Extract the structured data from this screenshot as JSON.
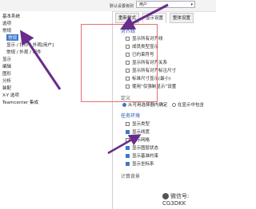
{
  "topbar": {
    "label": "默认设置级别",
    "select_value": "用户"
  },
  "tabs": [
    {
      "label": "重新样式"
    },
    {
      "label": "显示设置"
    },
    {
      "label": "整体设置"
    }
  ],
  "sidebar": {
    "items": [
      {
        "label": "基本系统"
      },
      {
        "label": "选项"
      },
      {
        "label": "常规"
      },
      {
        "label": "常规"
      },
      {
        "label": "显示 / 打印 / 外观[用户]"
      },
      {
        "label": "常规 / 外观 / 组件"
      },
      {
        "label": "显示"
      },
      {
        "label": "编辑"
      },
      {
        "label": "图形"
      },
      {
        "label": "分析"
      },
      {
        "label": "装配"
      },
      {
        "label": "X-Y 选项"
      },
      {
        "label": "Teamcenter 集成"
      }
    ]
  },
  "panel": {
    "section1_title": "对齐线",
    "options": [
      {
        "label": "显示所有对齐线",
        "checked": false
      },
      {
        "label": "成员类型显示",
        "checked": false
      },
      {
        "label": "已约束符号",
        "checked": false
      },
      {
        "label": "显示所有对齐关系",
        "checked": false
      },
      {
        "label": "显示所有对齐标注尺寸",
        "checked": false
      },
      {
        "label": "标准尺寸显示(最小)",
        "checked": false
      },
      {
        "label": "使用“仅强制显示”设置",
        "checked": false
      }
    ],
    "subsection_title": "定义",
    "radio_options": [
      {
        "label": "从可用选择器内确定",
        "selected": true
      },
      {
        "label": "在显示中包含",
        "selected": false
      }
    ],
    "section2_title": "任务环境",
    "options2": [
      {
        "label": "显示类型",
        "checked": false
      },
      {
        "label": "显示线宽",
        "checked": true
      },
      {
        "label": "显示网格",
        "checked": false
      },
      {
        "label": "显示图层状态",
        "checked": true
      },
      {
        "label": "显示基准约束",
        "checked": true
      },
      {
        "label": "显示坐标系",
        "checked": true
      }
    ],
    "footer_label": "计算背景"
  },
  "watermark": {
    "text": "微信号: CG3DKK"
  }
}
